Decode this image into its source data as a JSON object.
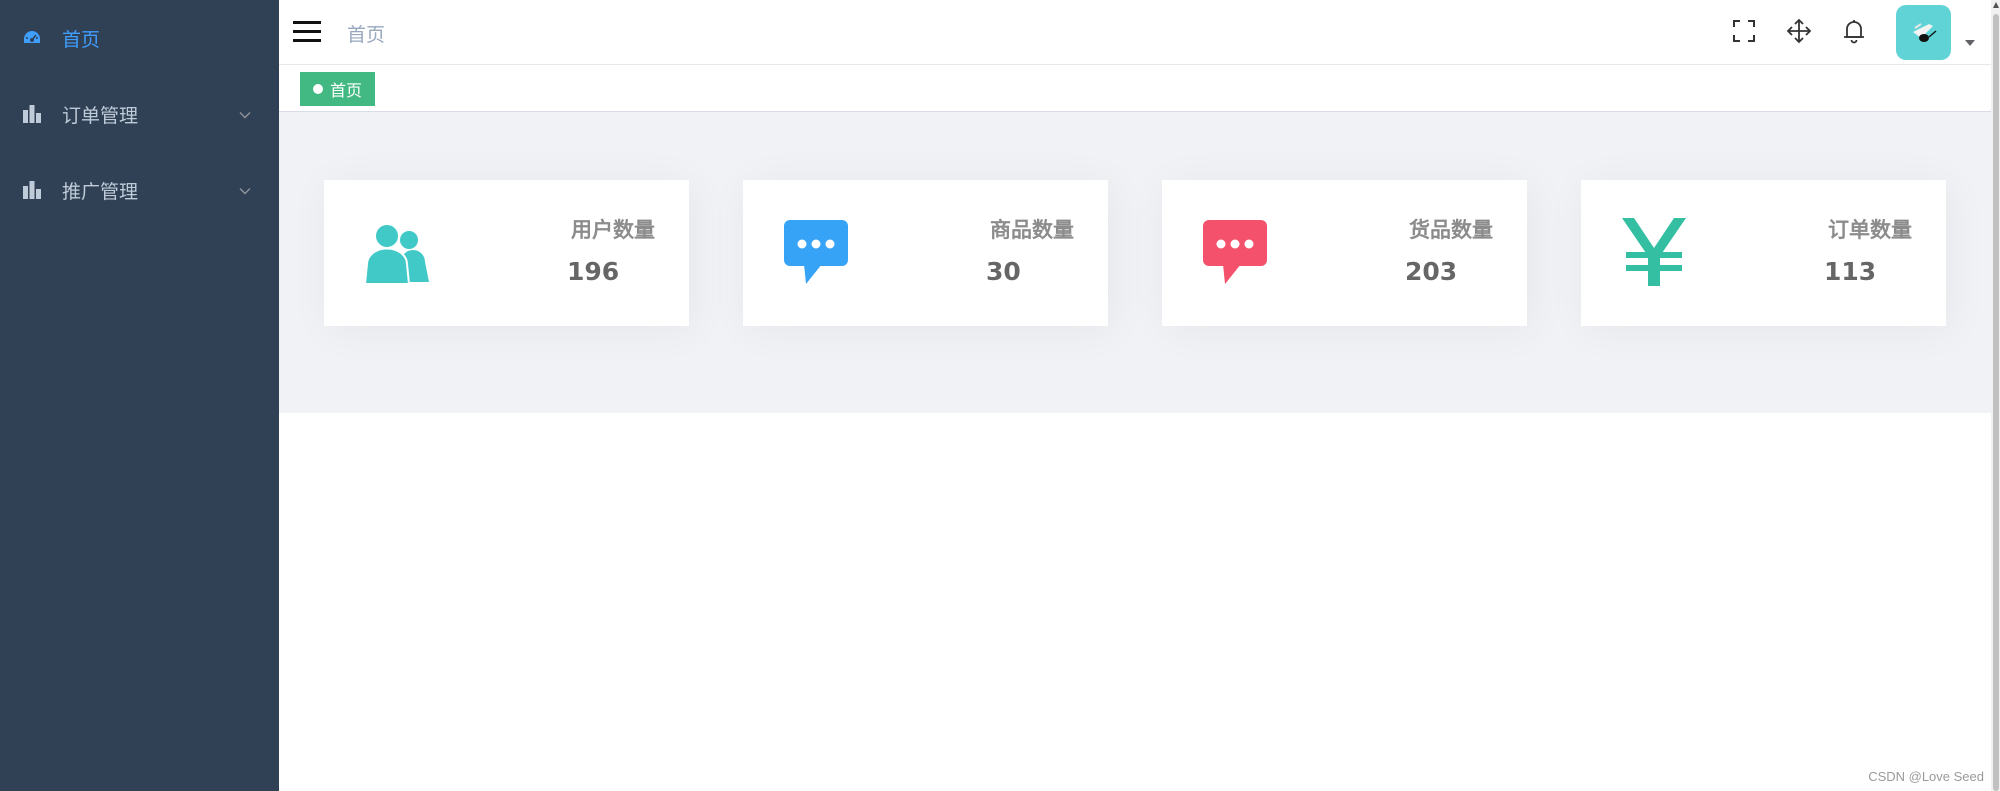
{
  "sidebar": {
    "items": [
      {
        "label": "首页",
        "icon": "dashboard-icon",
        "active": true
      },
      {
        "label": "订单管理",
        "icon": "chart-bar-icon",
        "expandable": true
      },
      {
        "label": "推广管理",
        "icon": "chart-bar-icon",
        "expandable": true
      }
    ]
  },
  "header": {
    "breadcrumb": "首页",
    "icons": [
      "fullscreen-icon",
      "move-icon",
      "bell-icon"
    ],
    "avatar": "user-avatar"
  },
  "tags": [
    {
      "label": "首页",
      "active": true
    }
  ],
  "cards": [
    {
      "label": "用户数量",
      "value": "196",
      "icon": "people-icon",
      "color": "#40c9c6"
    },
    {
      "label": "商品数量",
      "value": "30",
      "icon": "message-icon",
      "color": "#36a3f7"
    },
    {
      "label": "货品数量",
      "value": "203",
      "icon": "message-icon",
      "color": "#f4516c"
    },
    {
      "label": "订单数量",
      "value": "113",
      "icon": "yen-icon",
      "color": "#34bfa3"
    }
  ],
  "watermark": "CSDN @Love Seed",
  "colors": {
    "sidebar_bg": "#304156",
    "active_menu": "#409eff",
    "tag_active": "#42b983"
  }
}
